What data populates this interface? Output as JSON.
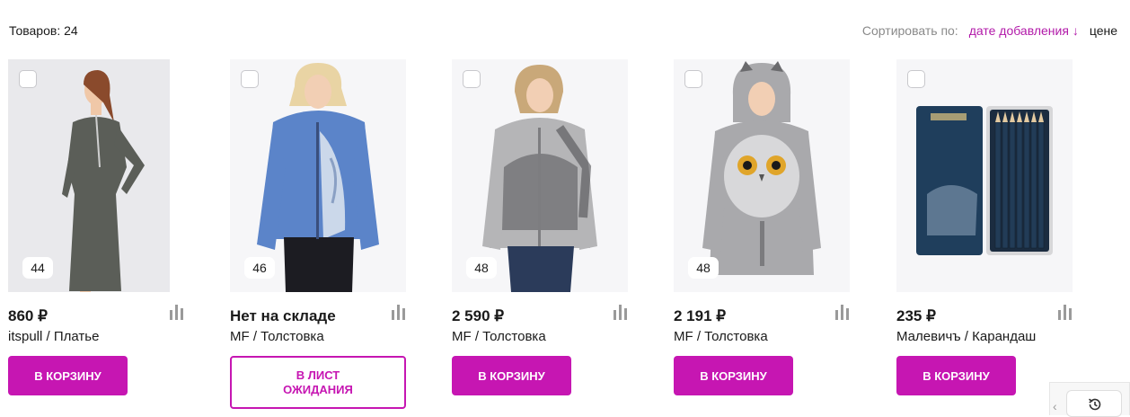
{
  "header": {
    "count_text": "Товаров: 24",
    "sort_label": "Сортировать по:",
    "sort_options": [
      {
        "label": "дате добавления ↓",
        "active": true
      },
      {
        "label": "цене",
        "active": false
      }
    ]
  },
  "products": [
    {
      "size": "44",
      "price": "860 ₽",
      "name": "itspull / Платье",
      "button": "В КОРЗИНУ",
      "button_type": "cart"
    },
    {
      "size": "46",
      "price": "Нет на складе",
      "name": "MF / Толстовка",
      "button": "В ЛИСТ ОЖИДАНИЯ",
      "button_type": "wait"
    },
    {
      "size": "48",
      "price": "2 590 ₽",
      "name": "MF / Толстовка",
      "button": "В КОРЗИНУ",
      "button_type": "cart"
    },
    {
      "size": "48",
      "price": "2 191 ₽",
      "name": "MF / Толстовка",
      "button": "В КОРЗИНУ",
      "button_type": "cart"
    },
    {
      "size": "",
      "price": "235 ₽",
      "name": "Малевичъ / Карандаш",
      "button": "В КОРЗИНУ",
      "button_type": "cart"
    }
  ],
  "colors": {
    "accent": "#c616b2",
    "muted": "#8a8a8a"
  },
  "icons": {
    "history": "history-icon",
    "stats": "stats-bars-icon",
    "chevron": "chevron-left-icon"
  }
}
